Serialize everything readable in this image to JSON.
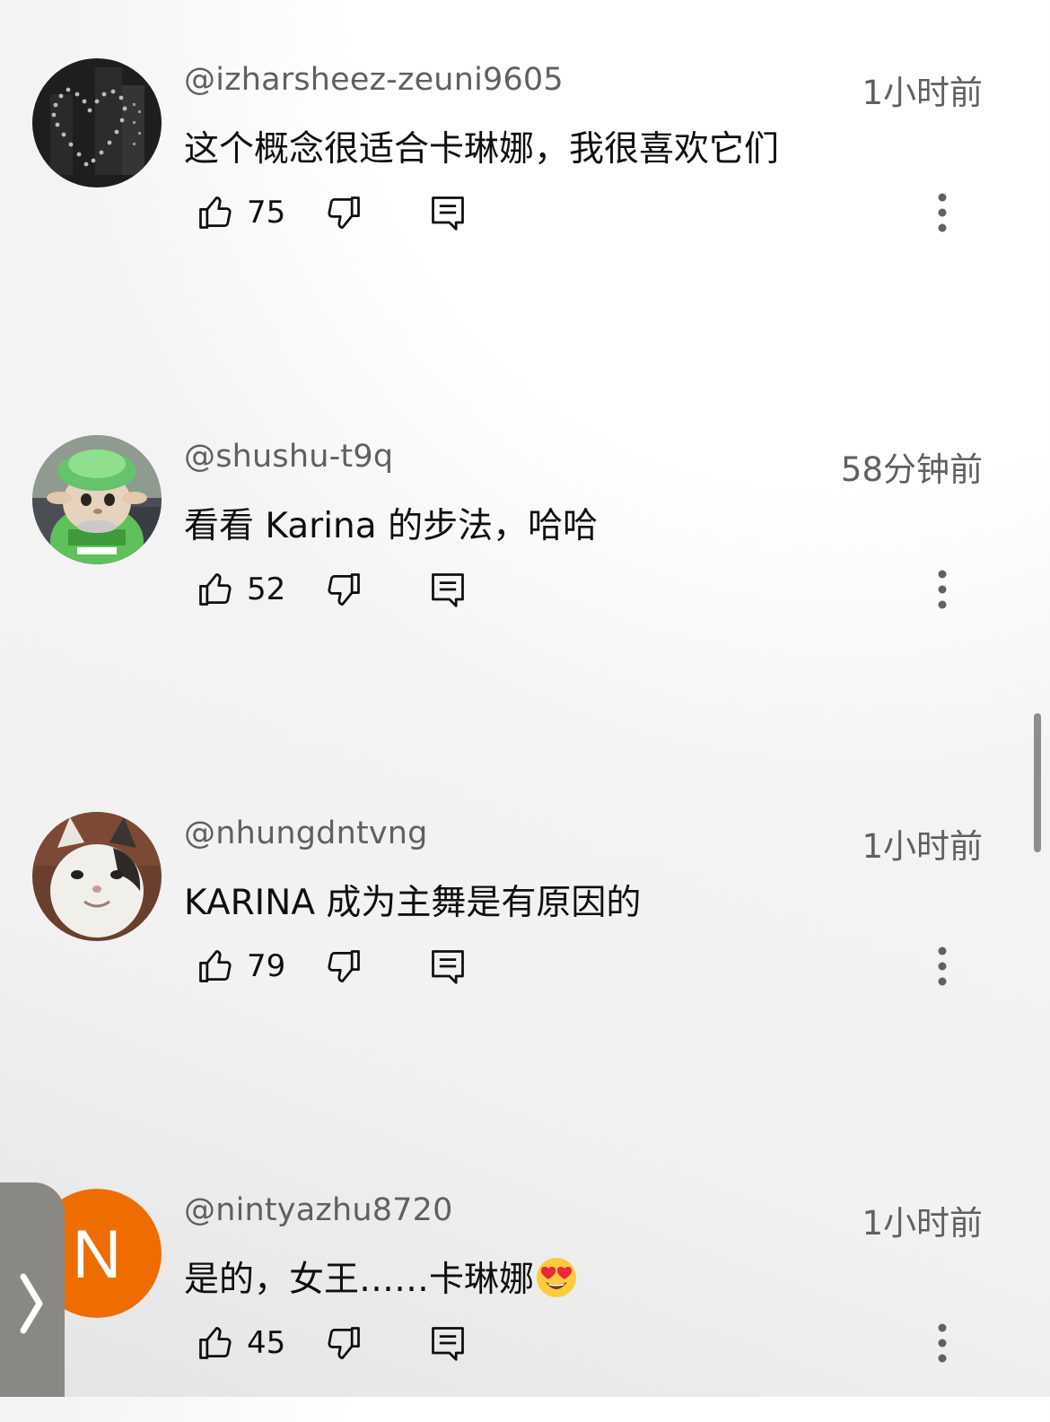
{
  "comments": [
    {
      "author": "@izharsheez-zeuni9605",
      "time": "1小时前",
      "text": "这个概念很适合卡琳娜，我很喜欢它们",
      "likes": "75",
      "avatar": "heart-city-night"
    },
    {
      "author": "@shushu-t9q",
      "time": "58分钟前",
      "text": "看看 Karina 的步法，哈哈",
      "likes": "52",
      "avatar": "green-hat-mascot"
    },
    {
      "author": "@nhungdntvng",
      "time": "1小时前",
      "text": "KARINA 成为主舞是有原因的",
      "likes": "79",
      "avatar": "smiling-cat"
    },
    {
      "author": "@nintyazhu8720",
      "time": "1小时前",
      "text": "是的，女王……卡琳娜",
      "emoji": "heart-eyes-emoji",
      "likes": "45",
      "avatar_letter": "N",
      "avatar_color": "#ef6c00"
    }
  ],
  "icons": {
    "like": "thumbs-up-icon",
    "dislike": "thumbs-down-icon",
    "reply": "reply-icon",
    "more": "more-vertical-icon",
    "side_tab": "chevron-right-icon"
  },
  "colors": {
    "secondary_text": "#606060",
    "primary_text": "#0f0f0f",
    "side_tab": "#8a8885"
  }
}
